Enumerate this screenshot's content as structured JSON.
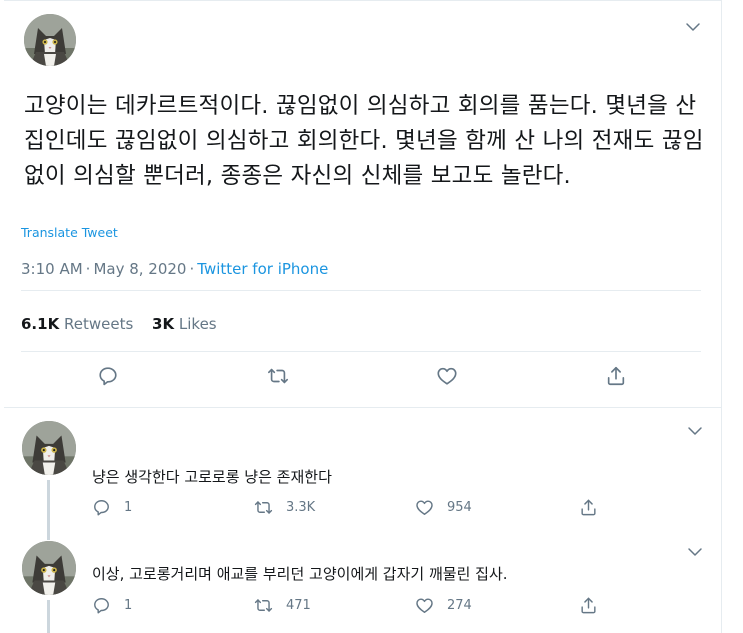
{
  "tweet": {
    "text": "고양이는 데카르트적이다. 끊임없이 의심하고 회의를 품는다. 몇년을 산 집인데도 끊임없이 의심하고 회의한다. 몇년을 함께 산 나의 전재도 끊임없이 의심할 뿐더러, 종종은 자신의 신체를 보고도 놀란다.",
    "translate_label": "Translate Tweet",
    "time": "3:10 AM",
    "date": "May 8, 2020",
    "separator": "·",
    "source": "Twitter for iPhone",
    "retweets_count": "6.1K",
    "retweets_label": "Retweets",
    "likes_count": "3K",
    "likes_label": "Likes"
  },
  "replies": [
    {
      "text": "냥은 생각한다 고로로롱 냥은 존재한다",
      "reply_count": "1",
      "retweet_count": "3.3K",
      "like_count": "954"
    },
    {
      "text": "이상, 고로롱거리며 애교를 부리던 고양이에게 갑자기 깨물린 집사.",
      "reply_count": "1",
      "retweet_count": "471",
      "like_count": "274"
    }
  ],
  "colors": {
    "text": "#14171a",
    "secondary": "#657786",
    "link": "#1b95e0",
    "border": "#e6ecf0",
    "thread": "#ccd6dd"
  },
  "icons": {
    "caret": "chevron-down-icon",
    "reply": "reply-icon",
    "retweet": "retweet-icon",
    "like": "heart-icon",
    "share": "share-icon"
  }
}
